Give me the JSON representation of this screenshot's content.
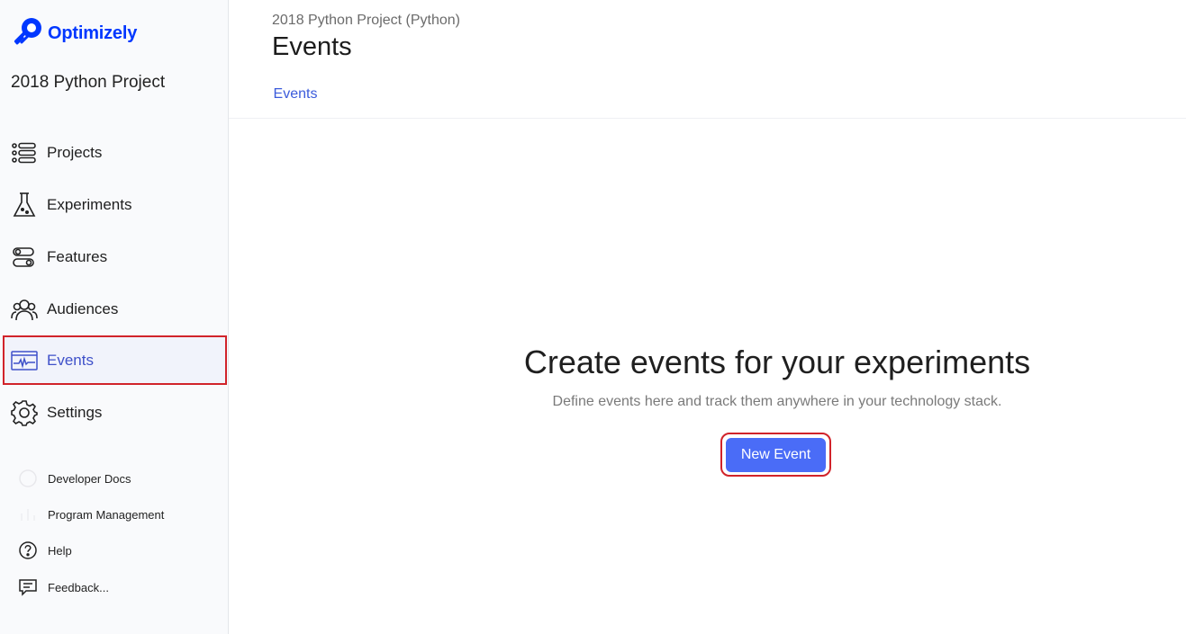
{
  "brand": {
    "name": "Optimizely",
    "color": "#0037ff"
  },
  "sidebar": {
    "project_name": "2018 Python Project",
    "items": [
      {
        "label": "Projects",
        "icon": "list-icon"
      },
      {
        "label": "Experiments",
        "icon": "flask-icon"
      },
      {
        "label": "Features",
        "icon": "toggle-icon"
      },
      {
        "label": "Audiences",
        "icon": "people-icon"
      },
      {
        "label": "Events",
        "icon": "pulse-icon",
        "active": true
      },
      {
        "label": "Settings",
        "icon": "gear-icon"
      }
    ],
    "links": [
      {
        "label": "Developer Docs",
        "icon": "code-icon"
      },
      {
        "label": "Program Management",
        "icon": "chart-icon"
      },
      {
        "label": "Help",
        "icon": "help-icon"
      },
      {
        "label": "Feedback...",
        "icon": "feedback-icon"
      }
    ]
  },
  "header": {
    "breadcrumb": "2018 Python Project (Python)",
    "title": "Events",
    "tabs": [
      {
        "label": "Events",
        "active": true
      }
    ]
  },
  "empty_state": {
    "title": "Create events for your experiments",
    "subtitle": "Define events here and track them anywhere in your technology stack.",
    "button_label": "New Event"
  },
  "colors": {
    "accent": "#4a6cf7",
    "active_text": "#3f51c9",
    "highlight_border": "#d1232a"
  }
}
